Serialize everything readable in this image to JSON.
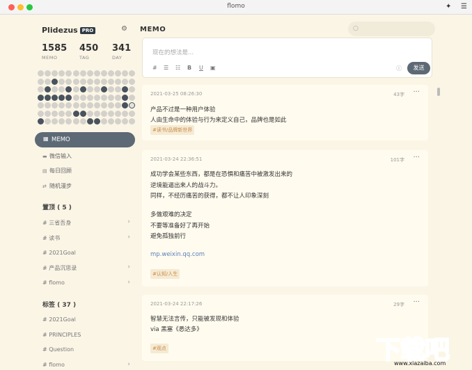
{
  "window": {
    "title": "flomo"
  },
  "sidebar": {
    "username": "Plidezus",
    "badge": "PRO",
    "stats": [
      {
        "value": "1585",
        "label": "MEMO"
      },
      {
        "value": "450",
        "label": "TAG"
      },
      {
        "value": "341",
        "label": "DAY"
      }
    ],
    "nav": [
      {
        "icon": "grid-icon",
        "label": "MEMO",
        "active": true
      },
      {
        "icon": "chat-icon",
        "label": "微信输入"
      },
      {
        "icon": "calendar-icon",
        "label": "每日回顾"
      },
      {
        "icon": "shuffle-icon",
        "label": "随机漫步"
      }
    ],
    "pinned_title": "置顶 ( 5 )",
    "pinned": [
      {
        "label": "# 三省吾身",
        "has_children": true
      },
      {
        "label": "# 读书",
        "has_children": true
      },
      {
        "label": "# 2021Goal",
        "has_children": false
      },
      {
        "label": "# 产品沉思录",
        "has_children": true
      },
      {
        "label": "# flomo",
        "has_children": true
      }
    ],
    "tags_title": "标签 ( 37 )",
    "tags": [
      {
        "label": "# 2021Goal",
        "has_children": false
      },
      {
        "label": "# PRINCIPLES",
        "has_children": false
      },
      {
        "label": "# Question",
        "has_children": false
      },
      {
        "label": "# flomo",
        "has_children": true
      }
    ]
  },
  "heatmap": {
    "rows": [
      [
        0,
        0,
        0,
        0,
        0,
        0,
        0,
        0,
        0,
        0,
        0,
        0,
        0,
        0
      ],
      [
        0,
        0,
        1,
        0,
        0,
        0,
        0,
        0,
        0,
        0,
        0,
        0,
        0,
        0
      ],
      [
        0,
        1,
        0,
        0,
        1,
        0,
        1,
        0,
        0,
        1,
        0,
        0,
        1,
        0
      ],
      [
        1,
        1,
        1,
        1,
        1,
        0,
        0,
        0,
        0,
        0,
        0,
        0,
        1,
        0
      ],
      [
        0,
        0,
        0,
        0,
        0,
        0,
        0,
        0,
        0,
        0,
        0,
        0,
        1,
        2
      ],
      [
        0,
        0,
        0,
        0,
        0,
        1,
        1,
        0,
        0,
        0,
        0,
        0,
        0,
        0
      ],
      [
        1,
        0,
        0,
        0,
        0,
        0,
        0,
        1,
        1,
        0,
        0,
        0,
        0,
        0
      ]
    ]
  },
  "main": {
    "title": "MEMO",
    "editor_placeholder": "现在的想法是...",
    "send_label": "发送",
    "memos": [
      {
        "time": "2021-03-25 08:26:30",
        "count": "43字",
        "lines": [
          "产品不过是一种用户体验",
          "人由生命中的体验与行为来定义自己，品牌也是如此"
        ],
        "tag": "#读书/品牌新世界"
      },
      {
        "time": "2021-03-24 22:36:51",
        "count": "101字",
        "lines": [
          "成功学会某些东西，都是在恐惧和痛苦中被激发出来的",
          "逆境能逼出来人的战斗力。",
          "同样，不经历痛苦的获得，都不让人印象深刻",
          "",
          "多做艰难的决定",
          "不要等准备好了再开始",
          "避免孤独前行",
          "",
          "mp.weixin.qq.com"
        ],
        "tag": "#认知/人生"
      },
      {
        "time": "2021-03-24 22:17:26",
        "count": "29字",
        "lines": [
          "智慧无法言传，只能被发现和体验",
          "via 黑塞《悉达多》"
        ],
        "tag": "#观点"
      }
    ]
  },
  "watermark": {
    "big": "下载吧",
    "small": "www.xiazaiba.com"
  }
}
